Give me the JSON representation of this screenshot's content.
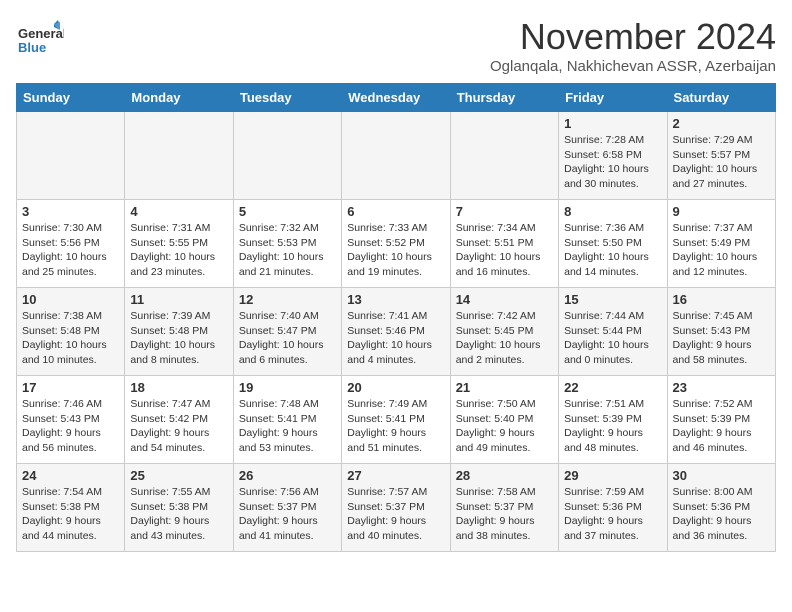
{
  "header": {
    "logo_general": "General",
    "logo_blue": "Blue",
    "title": "November 2024",
    "subtitle": "Oglanqala, Nakhichevan ASSR, Azerbaijan"
  },
  "days_of_week": [
    "Sunday",
    "Monday",
    "Tuesday",
    "Wednesday",
    "Thursday",
    "Friday",
    "Saturday"
  ],
  "weeks": [
    [
      {
        "day": "",
        "info": ""
      },
      {
        "day": "",
        "info": ""
      },
      {
        "day": "",
        "info": ""
      },
      {
        "day": "",
        "info": ""
      },
      {
        "day": "",
        "info": ""
      },
      {
        "day": "1",
        "info": "Sunrise: 7:28 AM\nSunset: 6:58 PM\nDaylight: 10 hours and 30 minutes."
      },
      {
        "day": "2",
        "info": "Sunrise: 7:29 AM\nSunset: 5:57 PM\nDaylight: 10 hours and 27 minutes."
      }
    ],
    [
      {
        "day": "3",
        "info": "Sunrise: 7:30 AM\nSunset: 5:56 PM\nDaylight: 10 hours and 25 minutes."
      },
      {
        "day": "4",
        "info": "Sunrise: 7:31 AM\nSunset: 5:55 PM\nDaylight: 10 hours and 23 minutes."
      },
      {
        "day": "5",
        "info": "Sunrise: 7:32 AM\nSunset: 5:53 PM\nDaylight: 10 hours and 21 minutes."
      },
      {
        "day": "6",
        "info": "Sunrise: 7:33 AM\nSunset: 5:52 PM\nDaylight: 10 hours and 19 minutes."
      },
      {
        "day": "7",
        "info": "Sunrise: 7:34 AM\nSunset: 5:51 PM\nDaylight: 10 hours and 16 minutes."
      },
      {
        "day": "8",
        "info": "Sunrise: 7:36 AM\nSunset: 5:50 PM\nDaylight: 10 hours and 14 minutes."
      },
      {
        "day": "9",
        "info": "Sunrise: 7:37 AM\nSunset: 5:49 PM\nDaylight: 10 hours and 12 minutes."
      }
    ],
    [
      {
        "day": "10",
        "info": "Sunrise: 7:38 AM\nSunset: 5:48 PM\nDaylight: 10 hours and 10 minutes."
      },
      {
        "day": "11",
        "info": "Sunrise: 7:39 AM\nSunset: 5:48 PM\nDaylight: 10 hours and 8 minutes."
      },
      {
        "day": "12",
        "info": "Sunrise: 7:40 AM\nSunset: 5:47 PM\nDaylight: 10 hours and 6 minutes."
      },
      {
        "day": "13",
        "info": "Sunrise: 7:41 AM\nSunset: 5:46 PM\nDaylight: 10 hours and 4 minutes."
      },
      {
        "day": "14",
        "info": "Sunrise: 7:42 AM\nSunset: 5:45 PM\nDaylight: 10 hours and 2 minutes."
      },
      {
        "day": "15",
        "info": "Sunrise: 7:44 AM\nSunset: 5:44 PM\nDaylight: 10 hours and 0 minutes."
      },
      {
        "day": "16",
        "info": "Sunrise: 7:45 AM\nSunset: 5:43 PM\nDaylight: 9 hours and 58 minutes."
      }
    ],
    [
      {
        "day": "17",
        "info": "Sunrise: 7:46 AM\nSunset: 5:43 PM\nDaylight: 9 hours and 56 minutes."
      },
      {
        "day": "18",
        "info": "Sunrise: 7:47 AM\nSunset: 5:42 PM\nDaylight: 9 hours and 54 minutes."
      },
      {
        "day": "19",
        "info": "Sunrise: 7:48 AM\nSunset: 5:41 PM\nDaylight: 9 hours and 53 minutes."
      },
      {
        "day": "20",
        "info": "Sunrise: 7:49 AM\nSunset: 5:41 PM\nDaylight: 9 hours and 51 minutes."
      },
      {
        "day": "21",
        "info": "Sunrise: 7:50 AM\nSunset: 5:40 PM\nDaylight: 9 hours and 49 minutes."
      },
      {
        "day": "22",
        "info": "Sunrise: 7:51 AM\nSunset: 5:39 PM\nDaylight: 9 hours and 48 minutes."
      },
      {
        "day": "23",
        "info": "Sunrise: 7:52 AM\nSunset: 5:39 PM\nDaylight: 9 hours and 46 minutes."
      }
    ],
    [
      {
        "day": "24",
        "info": "Sunrise: 7:54 AM\nSunset: 5:38 PM\nDaylight: 9 hours and 44 minutes."
      },
      {
        "day": "25",
        "info": "Sunrise: 7:55 AM\nSunset: 5:38 PM\nDaylight: 9 hours and 43 minutes."
      },
      {
        "day": "26",
        "info": "Sunrise: 7:56 AM\nSunset: 5:37 PM\nDaylight: 9 hours and 41 minutes."
      },
      {
        "day": "27",
        "info": "Sunrise: 7:57 AM\nSunset: 5:37 PM\nDaylight: 9 hours and 40 minutes."
      },
      {
        "day": "28",
        "info": "Sunrise: 7:58 AM\nSunset: 5:37 PM\nDaylight: 9 hours and 38 minutes."
      },
      {
        "day": "29",
        "info": "Sunrise: 7:59 AM\nSunset: 5:36 PM\nDaylight: 9 hours and 37 minutes."
      },
      {
        "day": "30",
        "info": "Sunrise: 8:00 AM\nSunset: 5:36 PM\nDaylight: 9 hours and 36 minutes."
      }
    ]
  ]
}
